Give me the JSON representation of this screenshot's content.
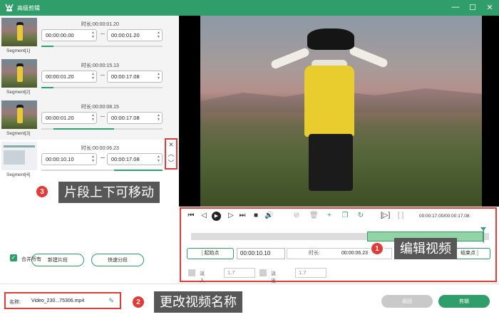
{
  "window": {
    "title": "高级剪辑"
  },
  "segments": [
    {
      "label": "Segment[1]",
      "duration_label": "时长:00:00:01.20",
      "start": "00:00:00.00",
      "end": "00:00:01.20",
      "progress_start": 0,
      "progress_end": 0.1
    },
    {
      "label": "Segment[2]",
      "duration_label": "时长:00:00:15.13",
      "start": "00:00:01.20",
      "end": "00:00:17.08",
      "progress_start": 0,
      "progress_end": 0.1
    },
    {
      "label": "Segment[3]",
      "duration_label": "时长:00:00:08.15",
      "start": "00:00:01.20",
      "end": "00:00:17.08",
      "progress_start": 0.1,
      "progress_end": 0.6
    },
    {
      "label": "Segment[4]",
      "duration_label": "时长:00:00:06.23",
      "start": "00:00:10.10",
      "end": "00:00:17.08",
      "progress_start": 0.6,
      "progress_end": 1.0
    }
  ],
  "callouts": {
    "move": {
      "num": "3",
      "text": "片段上下可移动"
    },
    "edit": {
      "num": "1",
      "text": "编辑视频"
    },
    "rename": {
      "num": "2",
      "text": "更改视频名称"
    }
  },
  "left_buttons": {
    "new_segment": "新建片段",
    "quick_split": "快速分段"
  },
  "merge": {
    "label": "合并所有",
    "checked": true
  },
  "name": {
    "label": "名称:",
    "value": "Video_230...75306.mp4"
  },
  "player": {
    "timecode": "00:00:17.00/00:00:17.08",
    "selection_start": 0.59,
    "selection_end": 0.98,
    "cursor": 0.98
  },
  "trim": {
    "start_label": "起始点",
    "start_value": "00:00:10.10",
    "duration_key": "时长:",
    "duration_value": "00:00:06.23",
    "end_label": "结束点"
  },
  "fade": {
    "in_label": "淡入",
    "in_value": "1.7",
    "out_label": "淡出",
    "out_value": "1.7"
  },
  "footer": {
    "back": "返回",
    "cut": "剪辑"
  },
  "colors": {
    "accent": "#2f9e6b",
    "highlight": "#e23b3b"
  }
}
